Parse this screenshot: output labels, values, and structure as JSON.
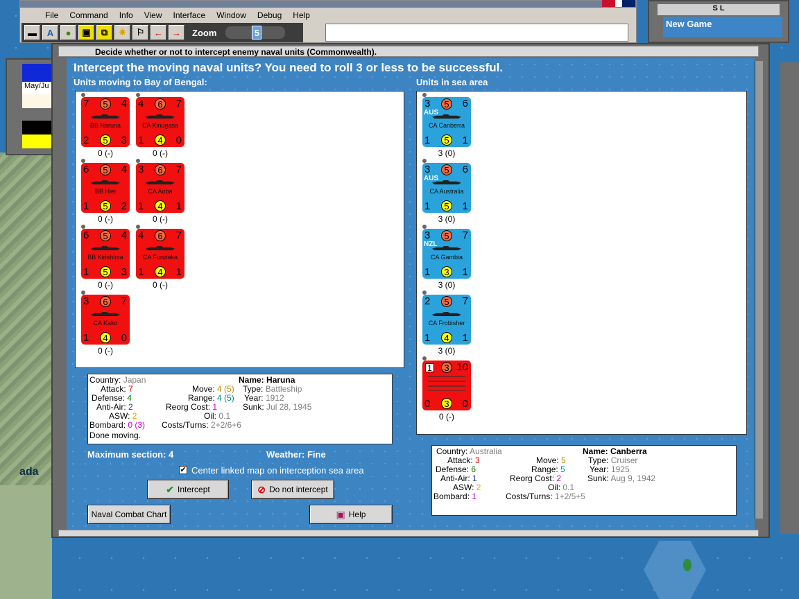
{
  "menu": [
    "File",
    "Command",
    "Info",
    "View",
    "Interface",
    "Window",
    "Debug",
    "Help"
  ],
  "toolbar": {
    "zoom_label": "Zoom",
    "zoom_value": "5"
  },
  "left_panel": {
    "date": "May/Ju"
  },
  "sl_window": {
    "title": "S L",
    "body": "New Game"
  },
  "map": {
    "label": "ada"
  },
  "dialog": {
    "title": "Decide whether or not to intercept enemy naval units (Commonwealth).",
    "heading": "Intercept the moving naval units?  You need to roll 3 or less to be successful.",
    "left_label": "Units moving to Bay of Bengal:",
    "right_label": "Units in sea area",
    "max_section": "Maximum section: 4",
    "weather": "Weather:  Fine",
    "center_checkbox": "Center linked map on interception sea area",
    "center_checked": "✔",
    "buttons": {
      "intercept": "Intercept",
      "do_not_intercept": "Do not intercept",
      "naval_chart": "Naval Combat Chart",
      "help": "Help"
    }
  },
  "moving_units": [
    {
      "tl": "7",
      "tc": "5",
      "tr": "4",
      "name": "BB Haruna",
      "bl": "2",
      "bc": "5",
      "br": "3",
      "status": "0 (-)"
    },
    {
      "tl": "4",
      "tc": "6",
      "tr": "7",
      "name": "CA Kinugasa",
      "bl": "1",
      "bc": "4",
      "br": "0",
      "status": "0 (-)"
    },
    {
      "tl": "6",
      "tc": "5",
      "tr": "4",
      "name": "BB Hiei",
      "bl": "1",
      "bc": "5",
      "br": "2",
      "status": "0 (-)"
    },
    {
      "tl": "3",
      "tc": "6",
      "tr": "7",
      "name": "CA Aoba",
      "bl": "1",
      "bc": "4",
      "br": "1",
      "status": "0 (-)"
    },
    {
      "tl": "6",
      "tc": "5",
      "tr": "4",
      "name": "BB Kirishima",
      "bl": "1",
      "bc": "5",
      "br": "3",
      "status": "0 (-)"
    },
    {
      "tl": "4",
      "tc": "6",
      "tr": "7",
      "name": "CA Furutaka",
      "bl": "1",
      "bc": "4",
      "br": "1",
      "status": "0 (-)"
    },
    {
      "tl": "3",
      "tc": "6",
      "tr": "7",
      "name": "CA Kako",
      "bl": "1",
      "bc": "4",
      "br": "0",
      "status": "0 (-)"
    }
  ],
  "sea_units": [
    {
      "nat": "AUS",
      "tl": "3",
      "tc": "5",
      "tr": "6",
      "name": "CA Canberra",
      "bl": "1",
      "bc": "5",
      "br": "1",
      "status": "3 (0)"
    },
    {
      "nat": "AUS",
      "tl": "3",
      "tc": "5",
      "tr": "6",
      "name": "CA Australia",
      "bl": "1",
      "bc": "5",
      "br": "1",
      "status": "3 (0)"
    },
    {
      "nat": "NZL",
      "tl": "3",
      "tc": "5",
      "tr": "7",
      "name": "CA Gambia",
      "bl": "1",
      "bc": "3",
      "br": "1",
      "status": "3 (0)"
    },
    {
      "nat": "",
      "tl": "2",
      "tc": "5",
      "tr": "7",
      "name": "CA Frobisher",
      "bl": "1",
      "bc": "4",
      "br": "1",
      "status": "3 (0)"
    },
    {
      "nat": "",
      "tl": "1",
      "tc": "3",
      "tr": "10",
      "name": "",
      "bl": "0",
      "bc": "3",
      "br": "0",
      "status": "0 (-)"
    }
  ],
  "info_left": {
    "country_l": "Country:",
    "country": "Japan",
    "attack_l": "Attack:",
    "attack": "7",
    "defense_l": "Defense:",
    "defense": "4",
    "antiair_l": "Anti-Air:",
    "antiair": "2",
    "asw_l": "ASW:",
    "asw": "2",
    "bombard_l": "Bombard:",
    "bombard": "0 (3)",
    "move_l": "Move:",
    "move": "4 (5)",
    "range_l": "Range:",
    "range": "4 (5)",
    "reorg_l": "Reorg Cost:",
    "reorg": "1",
    "oil_l": "Oil:",
    "oil": "0.1",
    "costs_l": "Costs/Turns:",
    "costs": "2+2/6+6",
    "name_l": "Name:",
    "name": "Haruna",
    "type_l": "Type:",
    "type": "Battleship",
    "year_l": "Year:",
    "year": "1912",
    "sunk_l": "Sunk:",
    "sunk": "Jul 28, 1945",
    "footer": "Done moving."
  },
  "info_right": {
    "country_l": "Country:",
    "country": "Australia",
    "attack_l": "Attack:",
    "attack": "3",
    "defense_l": "Defense:",
    "defense": "6",
    "antiair_l": "Anti-Air:",
    "antiair": "1",
    "asw_l": "ASW:",
    "asw": "2",
    "bombard_l": "Bombard:",
    "bombard": "1",
    "move_l": "Move:",
    "move": "5",
    "range_l": "Range:",
    "range": "5",
    "reorg_l": "Reorg Cost:",
    "reorg": "2",
    "oil_l": "Oil:",
    "oil": "0.1",
    "costs_l": "Costs/Turns:",
    "costs": "1+2/5+5",
    "name_l": "Name:",
    "name": "Canberra",
    "type_l": "Type:",
    "type": "Cruiser",
    "year_l": "Year:",
    "year": "1925",
    "sunk_l": "Sunk:",
    "sunk": "Aug 9, 1942"
  }
}
